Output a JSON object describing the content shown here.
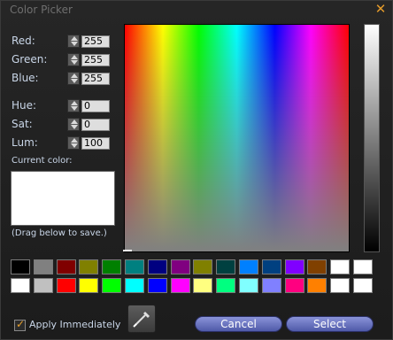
{
  "window": {
    "title": "Color Picker",
    "close_icon": "close-icon",
    "accent_color": "#e39a2a"
  },
  "rgb": {
    "red_label": "Red:",
    "red_value": "255",
    "green_label": "Green:",
    "green_value": "255",
    "blue_label": "Blue:",
    "blue_value": "255"
  },
  "hsl": {
    "hue_label": "Hue:",
    "hue_value": "0",
    "sat_label": "Sat:",
    "sat_value": "0",
    "lum_label": "Lum:",
    "lum_value": "100"
  },
  "current": {
    "label": "Current color:",
    "color": "#ffffff",
    "hint": "(Drag below to save.)"
  },
  "swatches": {
    "row1": [
      "#000000",
      "#808080",
      "#800000",
      "#808000",
      "#008000",
      "#008080",
      "#000080",
      "#800080",
      "#808000",
      "#004040",
      "#0080ff",
      "#004080",
      "#8000ff",
      "#804000",
      "#ffffff",
      "#ffffff"
    ],
    "row2": [
      "#ffffff",
      "#c0c0c0",
      "#ff0000",
      "#ffff00",
      "#00ff00",
      "#00ffff",
      "#0000ff",
      "#ff00ff",
      "#ffff80",
      "#00ff80",
      "#80ffff",
      "#8080ff",
      "#ff0080",
      "#ff8000",
      "#ffffff",
      "#ffffff"
    ]
  },
  "footer": {
    "apply_label": "Apply Immediately",
    "apply_checked": true,
    "dropper_icon": "eyedropper-icon",
    "cancel_label": "Cancel",
    "select_label": "Select"
  }
}
